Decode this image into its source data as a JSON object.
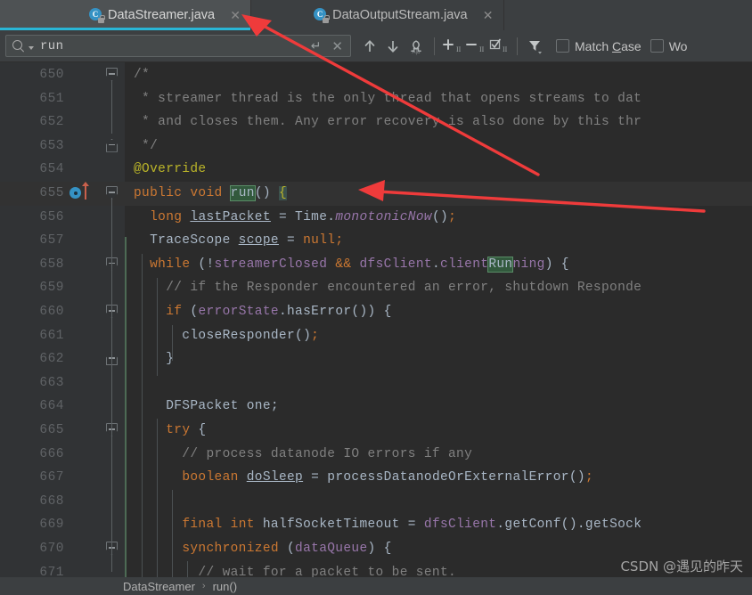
{
  "window": {
    "theme": "darcula",
    "accent_color": "#29b6d6",
    "editor_bg": "#2b2b2b",
    "gutter_bg": "#313335",
    "toolbar_bg": "#3c3f41"
  },
  "tabs": [
    {
      "label": "DataStreamer.java",
      "icon": "java-class-icon",
      "close": "✕",
      "active": true
    },
    {
      "label": "DataOutputStream.java",
      "icon": "java-class-icon",
      "close": "✕",
      "active": false
    }
  ],
  "search": {
    "value": "run",
    "placeholder": "Search",
    "search_icon": "magnifier-icon",
    "dropdown_icon": "chevron-down-icon",
    "enter_icon": "↵",
    "clear_icon": "✕",
    "buttons": [
      {
        "name": "find-previous",
        "icon": "arrow-up-icon",
        "label": "↑"
      },
      {
        "name": "find-next",
        "icon": "arrow-down-icon",
        "label": "↓"
      },
      {
        "name": "regex-toggle",
        "icon": "regex-omega-icon",
        "label": "Ω"
      },
      {
        "name": "add-selection-next-occurrence",
        "icon": "plus-selection-icon",
        "label": "+"
      },
      {
        "name": "remove-selection",
        "icon": "minus-selection-icon",
        "label": "−"
      },
      {
        "name": "select-all-occurrences",
        "icon": "check-selection-icon",
        "label": "☑"
      },
      {
        "name": "filter-options",
        "icon": "filter-funnel-icon",
        "label": "▼"
      }
    ],
    "checkboxes": [
      {
        "label": "Match Case",
        "mnemonic": "C",
        "checked": false
      },
      {
        "label": "Wo",
        "mnemonic": "",
        "checked": false,
        "truncated": true
      }
    ]
  },
  "editor": {
    "first_line_number": 650,
    "current_line": 655,
    "lines": [
      {
        "n": 650,
        "fold": "open",
        "tokens": [
          {
            "t": "/*",
            "c": "c-cmt"
          }
        ]
      },
      {
        "n": 651,
        "tokens": [
          {
            "t": " * streamer thread is the only thread that opens streams to dat",
            "c": "c-cmt"
          }
        ]
      },
      {
        "n": 652,
        "tokens": [
          {
            "t": " * and closes them. Any error recovery is also done by this thr",
            "c": "c-cmt"
          }
        ]
      },
      {
        "n": 653,
        "fold": "close",
        "tokens": [
          {
            "t": " */",
            "c": "c-cmt"
          }
        ]
      },
      {
        "n": 654,
        "tokens": [
          {
            "t": "@Override",
            "c": "c-anno"
          }
        ]
      },
      {
        "n": 655,
        "fold": "open",
        "current": true,
        "gutter_icon": "run-method-override-icon",
        "tokens": [
          {
            "t": "public",
            "c": "c-kw"
          },
          {
            "t": " ",
            "c": "c-txt"
          },
          {
            "t": "void",
            "c": "c-kw"
          },
          {
            "t": " ",
            "c": "c-txt"
          },
          {
            "t": "run",
            "c": "hl-find"
          },
          {
            "t": "() ",
            "c": "c-txt"
          },
          {
            "t": "{",
            "c": "hl-brace"
          }
        ]
      },
      {
        "n": 656,
        "tokens": [
          {
            "t": "  ",
            "c": "c-txt"
          },
          {
            "t": "long",
            "c": "c-kw"
          },
          {
            "t": " ",
            "c": "c-txt"
          },
          {
            "t": "lastPacket",
            "c": "c-local"
          },
          {
            "t": " = Time.",
            "c": "c-txt"
          },
          {
            "t": "monotonicNow",
            "c": "c-stat"
          },
          {
            "t": "()",
            "c": "c-txt"
          },
          {
            "t": ";",
            "c": "c-semi"
          }
        ]
      },
      {
        "n": 657,
        "tokens": [
          {
            "t": "  TraceScope ",
            "c": "c-txt"
          },
          {
            "t": "scope",
            "c": "c-local"
          },
          {
            "t": " = ",
            "c": "c-txt"
          },
          {
            "t": "null",
            "c": "c-kw"
          },
          {
            "t": ";",
            "c": "c-semi"
          }
        ]
      },
      {
        "n": 658,
        "fold": "open",
        "tokens": [
          {
            "t": "  ",
            "c": "c-txt"
          },
          {
            "t": "while",
            "c": "c-kw"
          },
          {
            "t": " (!",
            "c": "c-txt"
          },
          {
            "t": "streamerClosed",
            "c": "c-fld"
          },
          {
            "t": " && ",
            "c": "c-kw"
          },
          {
            "t": "dfsClient",
            "c": "c-fld"
          },
          {
            "t": ".",
            "c": "c-txt"
          },
          {
            "t": "client",
            "c": "c-fld"
          },
          {
            "t": "Run",
            "c": "hl-find"
          },
          {
            "t": "ning",
            "c": "c-fld"
          },
          {
            "t": ") {",
            "c": "c-txt"
          }
        ]
      },
      {
        "n": 659,
        "tokens": [
          {
            "t": "    // if the Responder encountered an error, shutdown Responde",
            "c": "c-cmt"
          }
        ]
      },
      {
        "n": 660,
        "fold": "open",
        "tokens": [
          {
            "t": "    ",
            "c": "c-txt"
          },
          {
            "t": "if",
            "c": "c-kw"
          },
          {
            "t": " (",
            "c": "c-txt"
          },
          {
            "t": "errorState",
            "c": "c-fld"
          },
          {
            "t": ".hasError()) {",
            "c": "c-txt"
          }
        ]
      },
      {
        "n": 661,
        "tokens": [
          {
            "t": "      closeResponder()",
            "c": "c-txt"
          },
          {
            "t": ";",
            "c": "c-semi"
          }
        ]
      },
      {
        "n": 662,
        "fold": "close",
        "tokens": [
          {
            "t": "    }",
            "c": "c-txt"
          }
        ]
      },
      {
        "n": 663,
        "tokens": []
      },
      {
        "n": 664,
        "tokens": [
          {
            "t": "    DFSPacket one;",
            "c": "c-txt"
          }
        ]
      },
      {
        "n": 665,
        "fold": "open",
        "tokens": [
          {
            "t": "    ",
            "c": "c-txt"
          },
          {
            "t": "try",
            "c": "c-kw"
          },
          {
            "t": " {",
            "c": "c-txt"
          }
        ]
      },
      {
        "n": 666,
        "tokens": [
          {
            "t": "      // process datanode IO errors if any",
            "c": "c-cmt"
          }
        ]
      },
      {
        "n": 667,
        "tokens": [
          {
            "t": "      ",
            "c": "c-txt"
          },
          {
            "t": "boolean",
            "c": "c-kw"
          },
          {
            "t": " ",
            "c": "c-txt"
          },
          {
            "t": "doSleep",
            "c": "c-local"
          },
          {
            "t": " = processDatanodeOrExternalError()",
            "c": "c-txt"
          },
          {
            "t": ";",
            "c": "c-semi"
          }
        ]
      },
      {
        "n": 668,
        "tokens": []
      },
      {
        "n": 669,
        "tokens": [
          {
            "t": "      ",
            "c": "c-txt"
          },
          {
            "t": "final",
            "c": "c-kw"
          },
          {
            "t": " ",
            "c": "c-txt"
          },
          {
            "t": "int",
            "c": "c-kw"
          },
          {
            "t": " halfSocketTimeout = ",
            "c": "c-txt"
          },
          {
            "t": "dfsClient",
            "c": "c-fld"
          },
          {
            "t": ".getConf().getSock",
            "c": "c-txt"
          }
        ]
      },
      {
        "n": 670,
        "fold": "open",
        "tokens": [
          {
            "t": "      ",
            "c": "c-txt"
          },
          {
            "t": "synchronized",
            "c": "c-kw"
          },
          {
            "t": " (",
            "c": "c-txt"
          },
          {
            "t": "dataQueue",
            "c": "c-fld"
          },
          {
            "t": ") {",
            "c": "c-txt"
          }
        ]
      },
      {
        "n": 671,
        "tokens": [
          {
            "t": "        // wait for a packet to be sent.",
            "c": "c-cmt"
          }
        ]
      }
    ]
  },
  "breadcrumb": {
    "items": [
      "DataStreamer",
      "run()"
    ],
    "separator": "›"
  },
  "watermark": {
    "text": "CSDN @遇见的昨天"
  },
  "annotations": [
    {
      "name": "arrow-to-active-tab",
      "color": "#ef3b3b"
    },
    {
      "name": "arrow-to-run-method",
      "color": "#ef3b3b"
    }
  ]
}
